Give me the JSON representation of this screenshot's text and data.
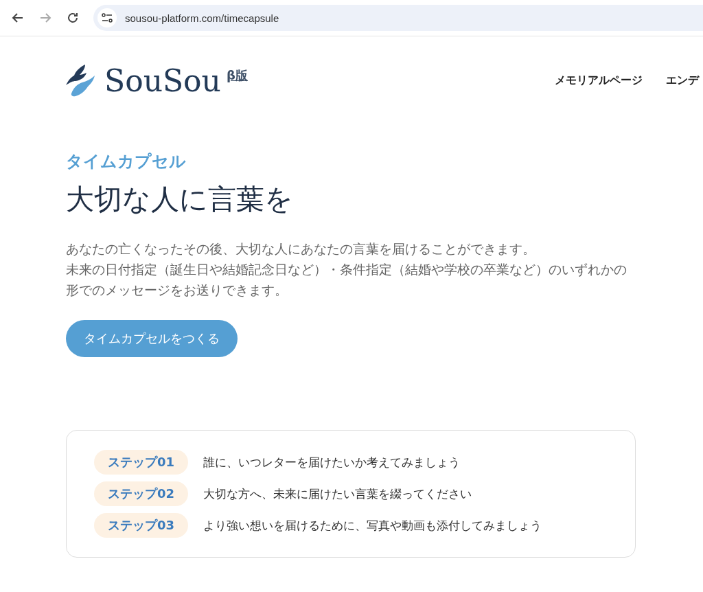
{
  "browser": {
    "url": "sousou-platform.com/timecapsule"
  },
  "header": {
    "logo": "SouSou",
    "beta": "β版",
    "nav": [
      "メモリアルページ",
      "エンデ"
    ]
  },
  "hero": {
    "kicker": "タイムカプセル",
    "title": "大切な人に言葉を",
    "lines": [
      "あなたの亡くなったその後、大切な人にあなたの言葉を届けることができます。",
      "未来の日付指定（誕生日や結婚記念日など）・条件指定（結婚や学校の卒業など）のいずれかの形でのメッセージをお送りできます。"
    ],
    "button": "タイムカプセルをつくる"
  },
  "steps": [
    {
      "label": "ステップ01",
      "text": "誰に、いつレターを届けたいか考えてみましょう"
    },
    {
      "label": "ステップ02",
      "text": "大切な方へ、未来に届けたい言葉を綴ってください"
    },
    {
      "label": "ステップ03",
      "text": "より強い想いを届けるために、写真や動画も添付してみましょう"
    }
  ]
}
